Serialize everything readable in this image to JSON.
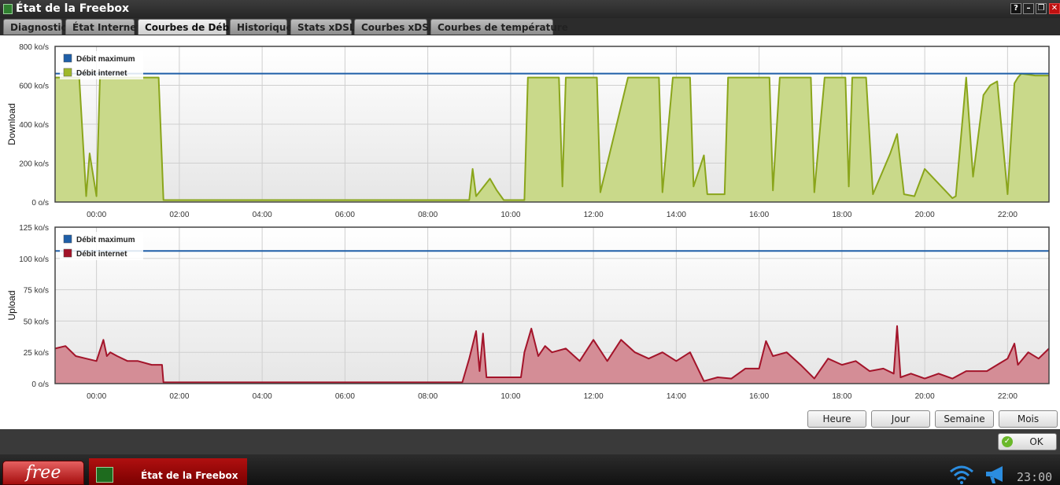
{
  "window": {
    "title": "État de la Freebox",
    "help_label": "?",
    "min_label": "–",
    "restore_label": "❐",
    "close_label": "✕"
  },
  "tabs": [
    {
      "label": "Diagnostic",
      "active": false
    },
    {
      "label": "État Internet",
      "active": false
    },
    {
      "label": "Courbes de Débit",
      "active": true
    },
    {
      "label": "Historique",
      "active": false
    },
    {
      "label": "Stats xDSL",
      "active": false
    },
    {
      "label": "Courbes xDSL",
      "active": false
    },
    {
      "label": "Courbes de température",
      "active": false
    }
  ],
  "colors": {
    "max_line": "#1f5fa8",
    "download_fill": "#c9d98a",
    "download_line": "#8aa51b",
    "upload_fill": "#d48d96",
    "upload_line": "#a3142a"
  },
  "chart_data": [
    {
      "type": "area",
      "ylabel": "Download",
      "ylim": [
        0,
        800
      ],
      "y_ticks": [
        "0 o/s",
        "200 ko/s",
        "400 ko/s",
        "600 ko/s",
        "800 ko/s"
      ],
      "x_ticks": [
        "00:00",
        "02:00",
        "04:00",
        "06:00",
        "08:00",
        "10:00",
        "12:00",
        "14:00",
        "16:00",
        "18:00",
        "20:00",
        "22:00"
      ],
      "x_range": [
        "23:00",
        "23:00"
      ],
      "legend": [
        {
          "name": "Débit maximum",
          "color": "#1f5fa8"
        },
        {
          "name": "Débit internet",
          "color": "#9fb82b"
        }
      ],
      "legend_position": "top-left",
      "grid": true,
      "series": [
        {
          "name": "Débit maximum",
          "values": [
            660,
            660
          ]
        },
        {
          "name": "Débit internet",
          "x": [
            "23:00",
            "23:35",
            "23:45",
            "23:50",
            "00:00",
            "00:05",
            "00:10",
            "01:30",
            "01:35",
            "01:37",
            "03:00",
            "05:00",
            "07:00",
            "08:50",
            "09:00",
            "09:05",
            "09:10",
            "09:30",
            "09:40",
            "09:50",
            "10:00",
            "10:20",
            "10:25",
            "11:10",
            "11:15",
            "11:20",
            "11:40",
            "12:05",
            "12:10",
            "12:50",
            "12:55",
            "13:35",
            "13:40",
            "13:55",
            "14:00",
            "14:20",
            "14:25",
            "14:40",
            "14:45",
            "15:10",
            "15:15",
            "16:15",
            "16:20",
            "16:30",
            "16:40",
            "17:15",
            "17:20",
            "17:35",
            "17:40",
            "18:05",
            "18:10",
            "18:15",
            "18:35",
            "18:45",
            "19:10",
            "19:20",
            "19:30",
            "19:45",
            "20:00",
            "20:40",
            "20:45",
            "21:00",
            "21:10",
            "21:25",
            "21:35",
            "21:45",
            "22:00",
            "22:10",
            "22:15",
            "22:20",
            "22:40",
            "23:00"
          ],
          "values": [
            640,
            640,
            30,
            250,
            30,
            640,
            640,
            640,
            200,
            10,
            10,
            10,
            10,
            10,
            10,
            170,
            30,
            120,
            60,
            10,
            10,
            10,
            640,
            640,
            80,
            640,
            640,
            640,
            50,
            640,
            640,
            640,
            50,
            640,
            640,
            640,
            80,
            240,
            40,
            40,
            640,
            640,
            60,
            640,
            640,
            640,
            50,
            640,
            640,
            640,
            80,
            640,
            640,
            40,
            250,
            350,
            40,
            30,
            170,
            20,
            30,
            640,
            130,
            550,
            600,
            620,
            40,
            610,
            640,
            660,
            650,
            650
          ]
        }
      ]
    },
    {
      "type": "area",
      "ylabel": "Upload",
      "ylim": [
        0,
        125
      ],
      "y_ticks": [
        "0 o/s",
        "25 ko/s",
        "50 ko/s",
        "75 ko/s",
        "100 ko/s",
        "125 ko/s"
      ],
      "x_ticks": [
        "00:00",
        "02:00",
        "04:00",
        "06:00",
        "08:00",
        "10:00",
        "12:00",
        "14:00",
        "16:00",
        "18:00",
        "20:00",
        "22:00"
      ],
      "x_range": [
        "23:00",
        "23:00"
      ],
      "legend": [
        {
          "name": "Débit maximum",
          "color": "#1f5fa8"
        },
        {
          "name": "Débit internet",
          "color": "#a3142a"
        }
      ],
      "legend_position": "top-left",
      "grid": true,
      "series": [
        {
          "name": "Débit maximum",
          "values": [
            106,
            106
          ]
        },
        {
          "name": "Débit internet",
          "x": [
            "23:00",
            "23:15",
            "23:30",
            "23:45",
            "00:00",
            "00:10",
            "00:15",
            "00:20",
            "00:30",
            "00:45",
            "01:00",
            "01:20",
            "01:35",
            "01:37",
            "02:00",
            "04:00",
            "06:00",
            "08:00",
            "08:50",
            "09:00",
            "09:10",
            "09:15",
            "09:20",
            "09:25",
            "09:30",
            "09:50",
            "10:15",
            "10:20",
            "10:30",
            "10:40",
            "10:50",
            "11:00",
            "11:20",
            "11:40",
            "12:00",
            "12:20",
            "12:40",
            "13:00",
            "13:20",
            "13:40",
            "14:00",
            "14:20",
            "14:40",
            "15:00",
            "15:20",
            "15:40",
            "16:00",
            "16:10",
            "16:20",
            "16:40",
            "17:00",
            "17:20",
            "17:40",
            "18:00",
            "18:20",
            "18:40",
            "19:00",
            "19:15",
            "19:20",
            "19:25",
            "19:40",
            "20:00",
            "20:20",
            "20:40",
            "21:00",
            "21:30",
            "21:45",
            "22:00",
            "22:10",
            "22:15",
            "22:30",
            "22:45",
            "23:00"
          ],
          "values": [
            28,
            30,
            22,
            20,
            18,
            35,
            22,
            25,
            22,
            18,
            18,
            15,
            15,
            1,
            1,
            1,
            1,
            1,
            1,
            20,
            42,
            10,
            40,
            5,
            5,
            5,
            5,
            25,
            44,
            22,
            30,
            25,
            28,
            18,
            35,
            18,
            35,
            25,
            20,
            25,
            18,
            25,
            2,
            5,
            4,
            12,
            12,
            34,
            22,
            25,
            15,
            4,
            20,
            15,
            18,
            10,
            12,
            8,
            46,
            5,
            8,
            4,
            8,
            4,
            10,
            10,
            15,
            20,
            32,
            15,
            25,
            20,
            28
          ]
        }
      ]
    }
  ],
  "range_buttons": [
    "Heure",
    "Jour",
    "Semaine",
    "Mois"
  ],
  "status": {
    "ok_label": "OK",
    "ok_icon": "checkmark-icon"
  },
  "taskbar": {
    "logo": "free",
    "task_label": "État de la Freebox",
    "clock": "23:00",
    "icons": [
      "wifi-icon",
      "megaphone-icon"
    ]
  }
}
